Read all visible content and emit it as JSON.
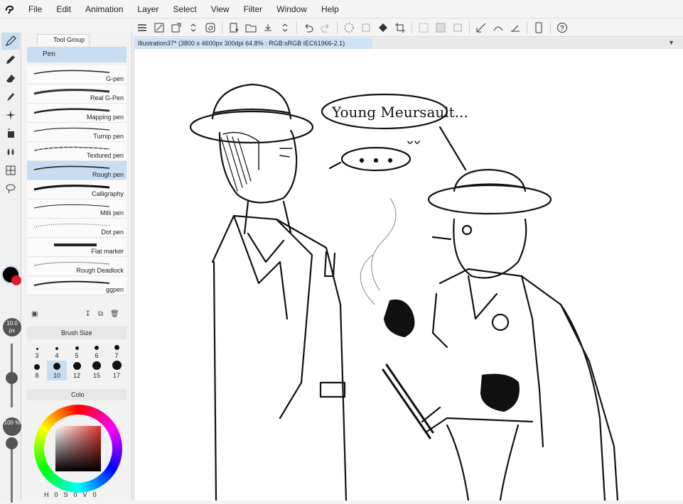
{
  "menubar": {
    "items": [
      "File",
      "Edit",
      "Animation",
      "Layer",
      "Select",
      "View",
      "Filter",
      "Window",
      "Help"
    ]
  },
  "document_tab": {
    "title": "Illustration37* (3800 x 4600px 300dpi 64.8% : RGB:sRGB IEC61966-2.1)"
  },
  "tool_panel": {
    "group_tab": "Tool Group",
    "subtool_header": "Pen",
    "brushes": [
      "G-pen",
      "Real G-Pen",
      "Mapping pen",
      "Turnip pen",
      "Textured pen",
      "Rough pen",
      "Calligraphy",
      "Milli pen",
      "Dot pen",
      "Flat marker",
      "Rough Deadlock",
      "ggpen"
    ],
    "selected_brush": "Rough pen"
  },
  "brush_size_panel": {
    "tab_label": "Brush Size",
    "sizes": [
      "3",
      "4",
      "5",
      "6",
      "7",
      "8",
      "10",
      "12",
      "15",
      "17"
    ],
    "selected_size": "10"
  },
  "side_widgets": {
    "brush_size_value": "10.0\npx",
    "opacity_value": "100\n%"
  },
  "color_panel": {
    "tab_label": "Colo",
    "hsv": {
      "h_label": "H",
      "h_value": "0",
      "s_label": "S",
      "s_value": "0",
      "v_label": "V",
      "v_value": "0"
    },
    "main_color": "#000000",
    "sub_color": "#e21a2c"
  },
  "canvas": {
    "speech_bubble_text": "Young Meursault...",
    "thought_bubble_text": "• • •"
  }
}
